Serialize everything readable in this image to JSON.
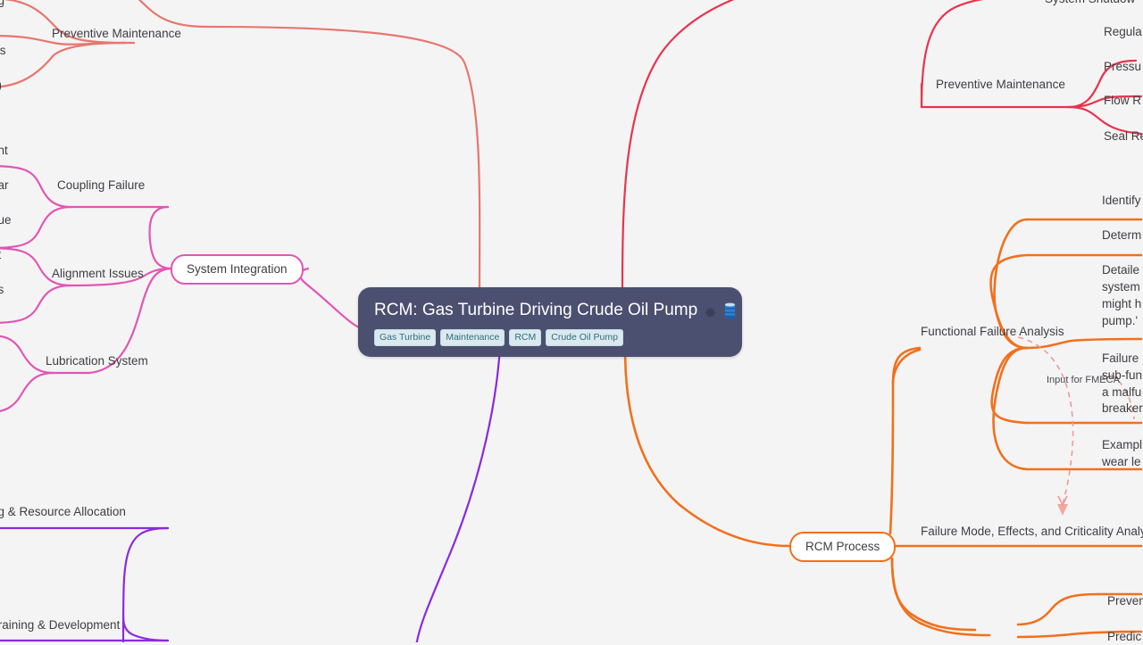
{
  "app": {
    "background": "#f4f4f5",
    "type": "mind-map"
  },
  "central": {
    "title": "RCM: Gas Turbine Driving Crude Oil Pump",
    "bg_color": "#4c5070",
    "icons": [
      "gear-icon",
      "oil-barrel-icon"
    ],
    "tags": [
      "Gas Turbine",
      "Maintenance",
      "RCM",
      "Crude Oil Pump"
    ]
  },
  "branches": {
    "preventive_maintenance_left": {
      "label": "Preventive Maintenance",
      "color": "#e8766e",
      "children": [
        "ng",
        "sis",
        "d)"
      ]
    },
    "preventive_maintenance_right": {
      "label": "Preventive Maintenance",
      "color": "#e8344e",
      "children": [
        "System Shutdow",
        "Regula",
        "Pressu",
        "Flow R",
        "Seal Re"
      ]
    },
    "system_integration": {
      "label": "System Integration",
      "color": "#e355b5",
      "children": [
        "Coupling Failure",
        "Alignment Issues",
        "Lubrication System"
      ],
      "grandchildren": [
        "ent",
        "ear",
        "gue",
        "nt",
        "es"
      ]
    },
    "rcm_process": {
      "label": "RCM Process",
      "color": "#f2701c",
      "children": [
        "Functional Failure Analysis",
        "Failure Mode, Effects, and Criticality Analy"
      ],
      "ffa_details": [
        "Identify",
        "Determ",
        "Detaile system might h pump.'",
        "Failure sub-fun a malfu breaker",
        "Exampl wear le"
      ],
      "fmeca_details": [
        "Preven",
        "Predic"
      ]
    },
    "resource_branch": {
      "color": "#8b2ae0",
      "children": [
        "ng & Resource Allocation",
        "Training & Development"
      ]
    }
  },
  "connector": {
    "label": "Input for FMECA",
    "style": "dashed-arrow",
    "color": "#f09a92"
  },
  "ffa_text": {
    "d1": "Identify",
    "d2": "Determ",
    "d3_l1": "Detaile",
    "d3_l2": "system",
    "d3_l3": "might h",
    "d3_l4": "pump.'",
    "d4_l1": "Failure",
    "d4_l2": "sub-fun",
    "d4_l3": "a malfu",
    "d4_l4": "breaker",
    "d5_l1": "Exampl",
    "d5_l2": "wear le"
  },
  "pm_right_children": {
    "c0": "System Shutdow",
    "c1": "Regula",
    "c2": "Pressu",
    "c3": "Flow R",
    "c4": "Seal Re"
  },
  "pm_left_children": {
    "c0": "ng",
    "c1": "sis",
    "c2": "d)"
  },
  "si_grandchildren": {
    "g0": "ent",
    "g1": "ear",
    "g2": "gue",
    "g3": "nt",
    "g4": "es"
  }
}
